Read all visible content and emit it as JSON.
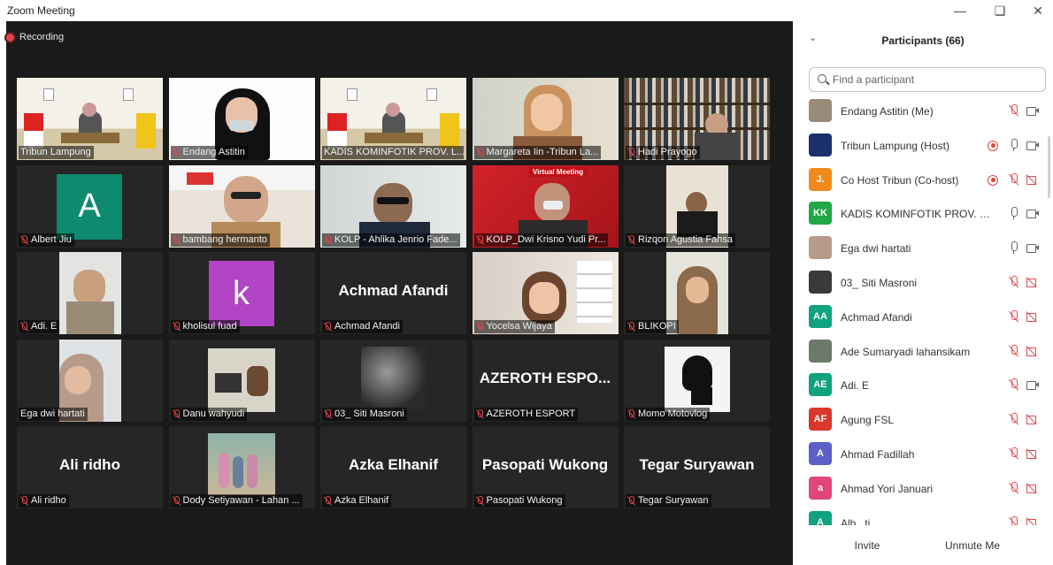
{
  "window": {
    "title": "Zoom Meeting",
    "minimize_icon": "minimize-icon",
    "restore_icon": "restore-icon",
    "close_icon": "close-icon"
  },
  "recording": {
    "label": "Recording"
  },
  "gallery": [
    {
      "name": "Tribun Lampung",
      "muted": false,
      "type": "video",
      "scene": "stage"
    },
    {
      "name": "Endang Astitin",
      "muted": true,
      "type": "video",
      "scene": "woman"
    },
    {
      "name": "KADIS KOMINFOTIK PROV. L...",
      "muted": false,
      "type": "video",
      "scene": "stage",
      "active": true
    },
    {
      "name": "Margareta Iin -Tribun La...",
      "muted": true,
      "type": "video",
      "scene": "woman-light"
    },
    {
      "name": "Hadi Prayogo",
      "muted": true,
      "type": "video",
      "scene": "books"
    },
    {
      "name": "Albert Jiu",
      "muted": true,
      "type": "avatar",
      "letter": "A",
      "color": "#0e8a6e"
    },
    {
      "name": "bambang hermanto",
      "muted": true,
      "type": "video",
      "scene": "man-banner"
    },
    {
      "name": "KOLP - Ahlika Jenrio Fade...",
      "muted": true,
      "type": "video",
      "scene": "man-office"
    },
    {
      "name": "KOLP_Dwi Krisno Yudi Pr...",
      "muted": true,
      "type": "video",
      "scene": "red-banner",
      "banner_text": "Virtual Meeting"
    },
    {
      "name": "Rizqon Agustia Fahsa",
      "muted": true,
      "type": "video",
      "scene": "small-person"
    },
    {
      "name": "Adi. E",
      "muted": true,
      "type": "video",
      "scene": "man-hand"
    },
    {
      "name": "kholisul fuad",
      "muted": true,
      "type": "avatar",
      "letter": "k",
      "color": "#b144c4"
    },
    {
      "name": "Achmad Afandi",
      "muted": true,
      "type": "text",
      "display": "Achmad Afandi"
    },
    {
      "name": "Yocelsa Wijaya",
      "muted": true,
      "type": "video",
      "scene": "woman-room"
    },
    {
      "name": "BLIKOPI",
      "muted": true,
      "type": "video",
      "scene": "hijab"
    },
    {
      "name": "Ega dwi hartati",
      "muted": false,
      "type": "video",
      "scene": "hijab-side"
    },
    {
      "name": "Danu wahyudi",
      "muted": true,
      "type": "video",
      "scene": "desk"
    },
    {
      "name": "03_ Siti Masroni",
      "muted": true,
      "type": "video",
      "scene": "plant"
    },
    {
      "name": "AZEROTH ESPORT",
      "muted": true,
      "type": "text",
      "display": "AZEROTH ESPO..."
    },
    {
      "name": "Momo Motovlog",
      "muted": true,
      "type": "video",
      "scene": "silhouette"
    },
    {
      "name": "Ali ridho",
      "muted": true,
      "type": "text",
      "display": "Ali ridho"
    },
    {
      "name": "Dody Setiyawan - Lahan ...",
      "muted": true,
      "type": "video",
      "scene": "family"
    },
    {
      "name": "Azka Elhanif",
      "muted": true,
      "type": "text",
      "display": "Azka Elhanif"
    },
    {
      "name": "Pasopati Wukong",
      "muted": true,
      "type": "text",
      "display": "Pasopati Wukong"
    },
    {
      "name": "Tegar Suryawan",
      "muted": true,
      "type": "text",
      "display": "Tegar Suryawan"
    }
  ],
  "participants": {
    "title": "Participants (66)",
    "search_placeholder": "Find a participant",
    "list": [
      {
        "name": "Endang Astitin (Me)",
        "avatar_type": "photo",
        "avatar_color": "#9a8a7a",
        "mic": "muted",
        "video": "on",
        "rec": false
      },
      {
        "name": "Tribun Lampung (Host)",
        "avatar_type": "photo",
        "avatar_color": "#1b2f6b",
        "mic": "on",
        "video": "on",
        "rec": true
      },
      {
        "name": "Co Host Tribun (Co-host)",
        "avatar_type": "letter",
        "initials": "J.",
        "avatar_color": "#f08a1c",
        "mic": "muted",
        "video": "off",
        "rec": true
      },
      {
        "name": "KADIS KOMINFOTIK PROV. LAM...",
        "avatar_type": "letter",
        "initials": "KK",
        "avatar_color": "#21a745",
        "mic": "on",
        "video": "on",
        "rec": false
      },
      {
        "name": "Ega dwi hartati",
        "avatar_type": "photo",
        "avatar_color": "#b89a8a",
        "mic": "on",
        "video": "on",
        "rec": false
      },
      {
        "name": "03_ Siti Masroni",
        "avatar_type": "photo",
        "avatar_color": "#3a3a3a",
        "mic": "muted",
        "video": "off",
        "rec": false
      },
      {
        "name": "Achmad Afandi",
        "avatar_type": "letter",
        "initials": "AA",
        "avatar_color": "#10a37f",
        "mic": "muted",
        "video": "off",
        "rec": false
      },
      {
        "name": "Ade Sumaryadi lahansikam",
        "avatar_type": "photo",
        "avatar_color": "#6c7a6a",
        "mic": "muted",
        "video": "off",
        "rec": false
      },
      {
        "name": "Adi. E",
        "avatar_type": "letter",
        "initials": "AE",
        "avatar_color": "#10a37f",
        "mic": "muted",
        "video": "on",
        "rec": false
      },
      {
        "name": "Agung FSL",
        "avatar_type": "letter",
        "initials": "AF",
        "avatar_color": "#d9372b",
        "mic": "muted",
        "video": "off",
        "rec": false
      },
      {
        "name": "Ahmad Fadillah",
        "avatar_type": "letter",
        "initials": "A",
        "avatar_color": "#5b5fc7",
        "mic": "muted",
        "video": "off",
        "rec": false
      },
      {
        "name": "Ahmad Yori Januari",
        "avatar_type": "letter",
        "initials": "a",
        "avatar_color": "#e0457b",
        "mic": "muted",
        "video": "off",
        "rec": false
      },
      {
        "name": "Alb...ti...",
        "avatar_type": "letter",
        "initials": "A",
        "avatar_color": "#10a37f",
        "mic": "muted",
        "video": "off",
        "rec": false
      }
    ]
  },
  "footer": {
    "invite_label": "Invite",
    "unmute_label": "Unmute Me"
  }
}
